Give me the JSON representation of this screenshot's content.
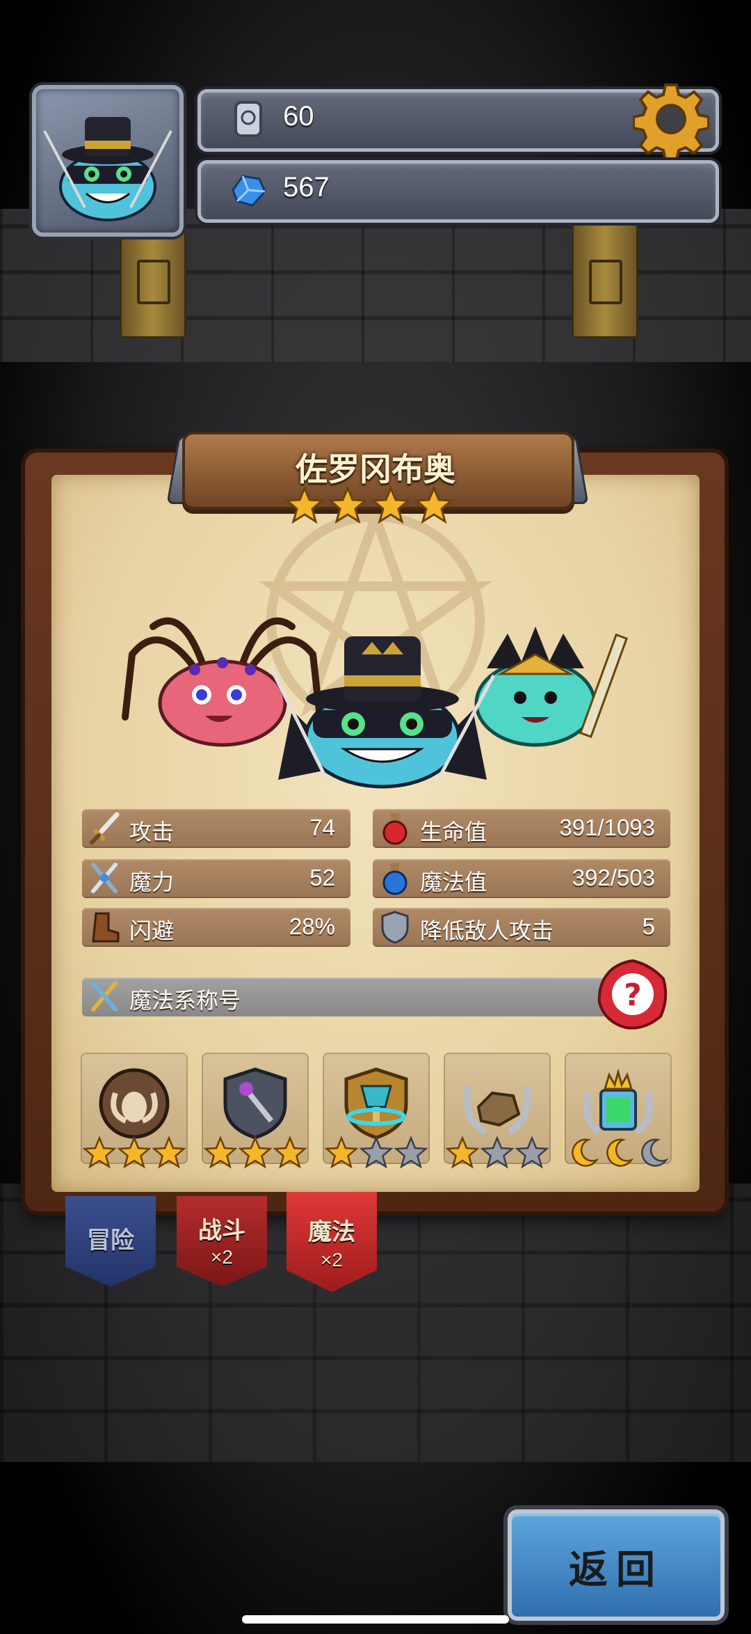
{
  "hud": {
    "resource_top": {
      "icon": "stone-tablet-icon",
      "value": "60"
    },
    "resource_bottom": {
      "icon": "blue-gem-icon",
      "value": "567"
    },
    "settings_icon": "gear-icon"
  },
  "hero": {
    "name": "佐罗冈布奥",
    "stars": 4
  },
  "stats": {
    "attack": {
      "label": "攻击",
      "value": "74",
      "icon": "sword-icon"
    },
    "magic": {
      "label": "魔力",
      "value": "52",
      "icon": "magic-swords-icon"
    },
    "dodge": {
      "label": "闪避",
      "value": "28%",
      "icon": "boot-icon"
    },
    "hp": {
      "label": "生命值",
      "value": "391/1093",
      "icon": "red-potion-icon"
    },
    "mp": {
      "label": "魔法值",
      "value": "392/503",
      "icon": "blue-potion-icon"
    },
    "defense": {
      "label": "降低敌人攻击",
      "value": "5",
      "icon": "shield-icon"
    }
  },
  "title_row": {
    "label": "魔法系称号",
    "help_icon": "question-mark-icon"
  },
  "skills": [
    {
      "icon": "ram-skull-emblem-icon",
      "stars_filled": 3,
      "stars_total": 3
    },
    {
      "icon": "dagger-shield-emblem-icon",
      "stars_filled": 3,
      "stars_total": 3
    },
    {
      "icon": "goblet-emblem-icon",
      "stars_filled": 1,
      "stars_total": 3
    },
    {
      "icon": "rock-laurel-emblem-icon",
      "stars_filled": 1,
      "stars_total": 3
    },
    {
      "icon": "portal-crown-emblem-icon",
      "moons_filled": 2,
      "moons_total": 3
    }
  ],
  "tabs": [
    {
      "label": "冒险",
      "mult": ""
    },
    {
      "label": "战斗",
      "mult": "×2"
    },
    {
      "label": "魔法",
      "mult": "×2"
    }
  ],
  "back_button": {
    "label": "返回"
  },
  "colors": {
    "panel_parchment": "#ecd9ad",
    "stat_bar": "#a6805f",
    "gold": "#f5b72a",
    "back_blue": "#3f86c4"
  }
}
